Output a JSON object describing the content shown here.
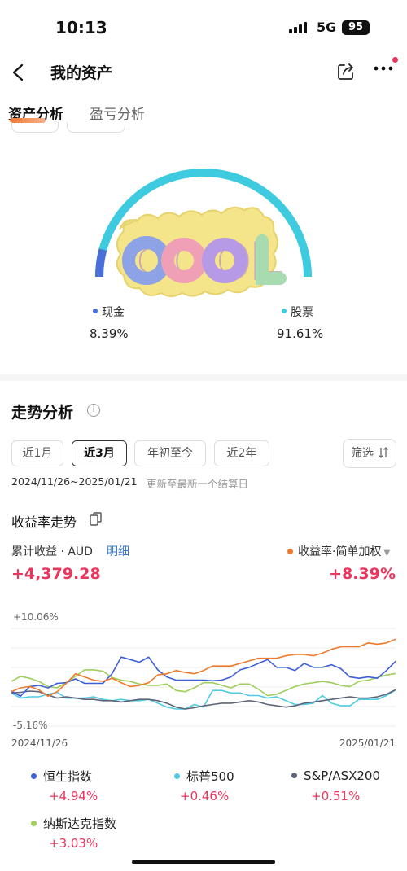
{
  "status_bar": {
    "time": "10:13",
    "network": "5G",
    "battery": "95"
  },
  "nav": {
    "title": "我的资产"
  },
  "tabs": [
    {
      "label": "资产分析"
    },
    {
      "label": "盈亏分析"
    }
  ],
  "allocation": {
    "items": [
      {
        "name": "现金",
        "percent": "8.39%",
        "value": 8.39,
        "color": "#4a6fd8"
      },
      {
        "name": "股票",
        "percent": "91.61%",
        "value": 91.61,
        "color": "#3ecbe0"
      }
    ],
    "badge_text": "COOL"
  },
  "trend": {
    "title": "走势分析",
    "info_icon": "i",
    "periods": [
      {
        "label": "近1月",
        "active": false
      },
      {
        "label": "近3月",
        "active": true
      },
      {
        "label": "年初至今",
        "active": false
      },
      {
        "label": "近2年",
        "active": false
      }
    ],
    "filter_label": "筛选",
    "date_range": "2024/11/26~2025/01/21",
    "date_note": "更新至最新一个结算日",
    "rate_title": "收益率走势",
    "cumulative_label": "累计收益 · AUD",
    "detail_link": "明细",
    "rate_label": "收益率·简单加权",
    "cumulative_value": "+4,379.28",
    "rate_value": "+8.39%"
  },
  "chart_data": {
    "type": "line",
    "x_start": "2024/11/26",
    "x_end": "2025/01/21",
    "y_max_label": "+10.06%",
    "y_min_label": "-5.16%",
    "ylim": [
      -5.16,
      10.06
    ],
    "grid": true,
    "series": [
      {
        "name": "收益率·简单加权",
        "color": "#f07a2c",
        "values": [
          0.2,
          0.8,
          1.0,
          0.5,
          -0.5,
          0.2,
          1.5,
          3.0,
          2.5,
          2.0,
          1.8,
          2.3,
          1.6,
          1.0,
          1.2,
          1.6,
          2.8,
          3.0,
          3.5,
          3.2,
          3.0,
          3.5,
          4.2,
          4.2,
          4.2,
          4.6,
          5.0,
          5.4,
          5.4,
          5.4,
          5.8,
          6.0,
          6.0,
          5.8,
          6.2,
          6.8,
          7.2,
          7.2,
          7.2,
          7.8,
          7.6,
          7.8,
          8.39
        ]
      },
      {
        "name": "恒生指数",
        "color": "#3d5fd6",
        "values": [
          0.3,
          -0.5,
          1.0,
          1.2,
          0.8,
          1.5,
          1.6,
          2.2,
          1.5,
          1.5,
          1.5,
          3.0,
          5.6,
          5.2,
          4.8,
          5.6,
          3.6,
          2.5,
          2.0,
          2.0,
          2.0,
          2.0,
          1.9,
          2.0,
          2.5,
          3.6,
          4.0,
          4.6,
          5.2,
          4.0,
          4.0,
          3.5,
          4.6,
          4.0,
          4.0,
          4.4,
          3.8,
          2.5,
          2.3,
          2.5,
          2.3,
          3.5,
          4.94
        ]
      },
      {
        "name": "标普500",
        "color": "#4fcbe3",
        "values": [
          0.0,
          -0.8,
          -0.6,
          -0.6,
          -0.2,
          0.1,
          -0.8,
          -0.8,
          -0.8,
          -0.6,
          -1.0,
          -1.2,
          -1.0,
          -1.2,
          -1.2,
          -1.0,
          -1.6,
          -2.2,
          -2.5,
          -2.5,
          -1.8,
          -2.2,
          0.4,
          0.4,
          0.0,
          0.0,
          -0.4,
          -0.4,
          -0.8,
          -0.6,
          -1.2,
          -1.8,
          -1.8,
          -1.6,
          -0.4,
          -1.6,
          -2.0,
          -2.0,
          -1.0,
          -1.0,
          -1.0,
          -0.4,
          0.46
        ]
      },
      {
        "name": "S&P/ASX200",
        "color": "#5d6478",
        "values": [
          0.0,
          0.1,
          0.3,
          0.2,
          -0.3,
          -0.8,
          -0.6,
          -0.8,
          -1.0,
          -1.0,
          -1.2,
          -1.2,
          -1.4,
          -1.2,
          -1.0,
          -1.0,
          -1.2,
          -1.6,
          -2.2,
          -2.5,
          -2.3,
          -2.0,
          -1.8,
          -1.6,
          -1.6,
          -1.4,
          -1.2,
          -1.4,
          -1.8,
          -2.0,
          -2.2,
          -2.0,
          -1.6,
          -1.4,
          -1.2,
          -1.0,
          -0.8,
          -0.6,
          -0.8,
          -0.8,
          -0.6,
          -0.2,
          0.51
        ]
      },
      {
        "name": "纳斯达克指数",
        "color": "#9fce5a",
        "values": [
          1.8,
          2.6,
          2.3,
          1.8,
          1.0,
          0.8,
          1.6,
          2.6,
          3.6,
          3.6,
          3.4,
          2.4,
          2.0,
          1.8,
          1.4,
          1.2,
          1.2,
          1.4,
          0.4,
          0.2,
          0.8,
          1.6,
          1.6,
          1.2,
          0.8,
          1.4,
          1.4,
          0.6,
          -0.4,
          -0.2,
          0.4,
          1.0,
          1.4,
          1.6,
          1.8,
          1.6,
          1.2,
          1.0,
          1.8,
          2.0,
          2.4,
          2.8,
          3.03
        ]
      }
    ]
  },
  "legend": [
    {
      "name": "恒生指数",
      "value": "+4.94%",
      "color": "#3d5fd6"
    },
    {
      "name": "标普500",
      "value": "+0.46%",
      "color": "#4fcbe3"
    },
    {
      "name": "S&P/ASX200",
      "value": "+0.51%",
      "color": "#5d6478"
    },
    {
      "name": "纳斯达克指数",
      "value": "+3.03%",
      "color": "#9fce5a"
    }
  ]
}
